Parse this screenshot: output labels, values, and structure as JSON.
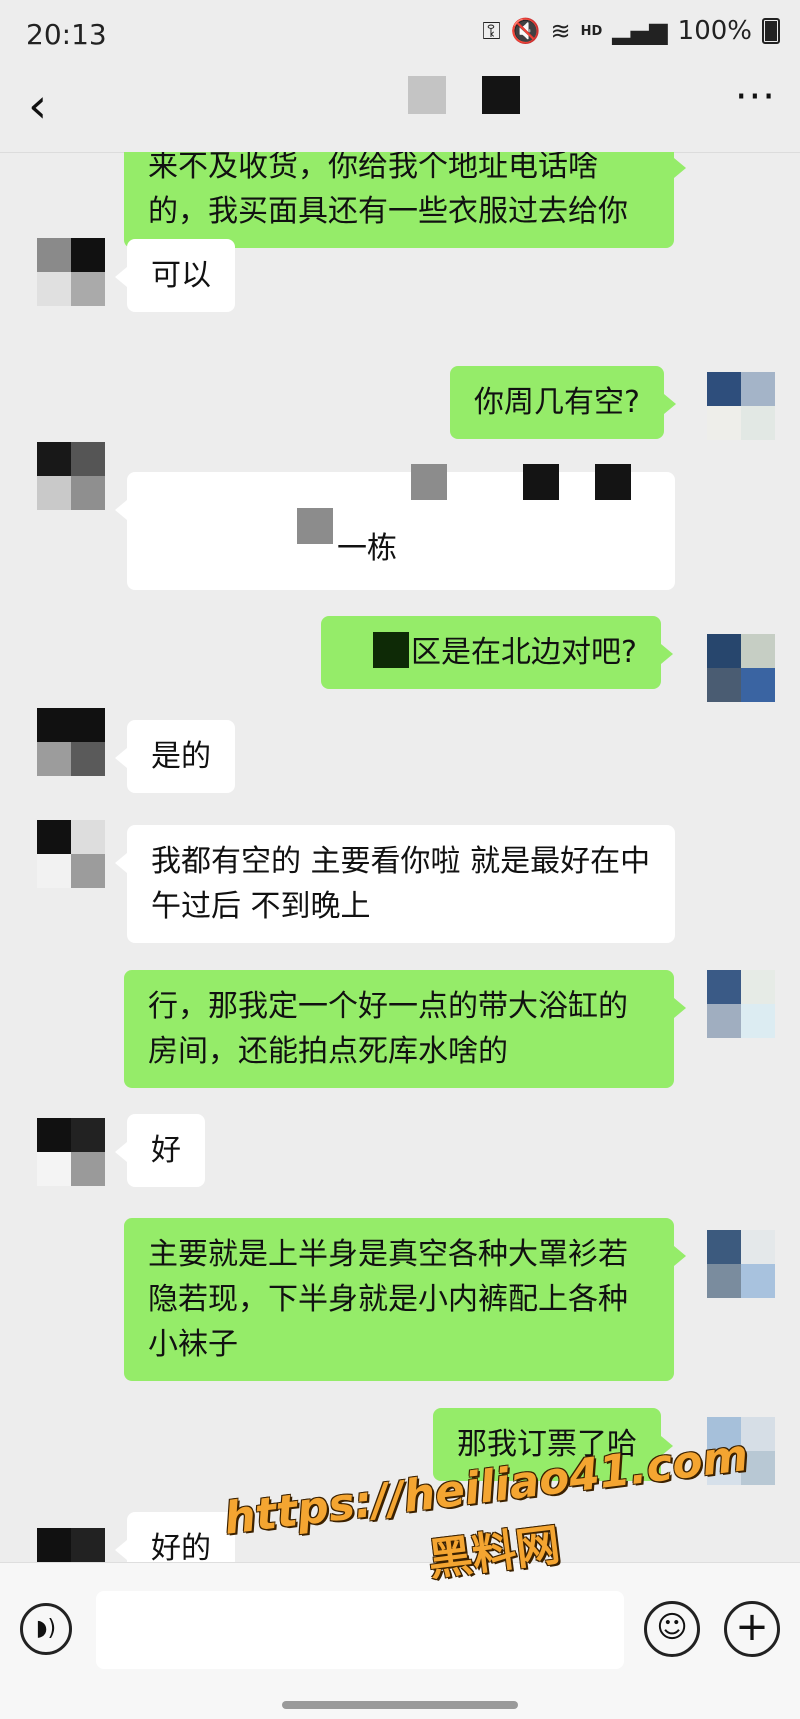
{
  "status_bar": {
    "time": "20:13",
    "hd_label": "HD",
    "battery": "100%"
  },
  "nav": {
    "back_icon": "chevron-left-icon",
    "more_icon": "more-dots-icon"
  },
  "messages": [
    {
      "side": "right",
      "text": "来不及收货，你给我个地址电话啥的，我买面具还有一些衣服过去给你"
    },
    {
      "side": "left",
      "text": "可以"
    },
    {
      "side": "right",
      "text": "你周几有空?"
    },
    {
      "side": "left",
      "text": "一栋"
    },
    {
      "side": "right",
      "text": "区是在北边对吧?"
    },
    {
      "side": "left",
      "text": "是的"
    },
    {
      "side": "left",
      "text": "我都有空的 主要看你啦 就是最好在中午过后 不到晚上"
    },
    {
      "side": "right",
      "text": "行，那我定一个好一点的带大浴缸的房间，还能拍点死库水啥的"
    },
    {
      "side": "left",
      "text": "好"
    },
    {
      "side": "right",
      "text": "主要就是上半身是真空各种大罩衫若隐若现，下半身就是小内裤配上各种小袜子"
    },
    {
      "side": "right",
      "text": "那我订票了哈"
    },
    {
      "side": "left",
      "text": "好的"
    }
  ],
  "input_bar": {
    "voice_icon": "voice-icon",
    "emoji_icon": "emoji-icon",
    "plus_icon": "plus-icon",
    "mic_icon": "mic-icon"
  },
  "watermark": {
    "url": "https://heiliao41.com",
    "name": "黑料网"
  },
  "colors": {
    "bubble_sent": "#95ec69",
    "bubble_received": "#ffffff",
    "background": "#ededed",
    "watermark": "#f4a531"
  }
}
